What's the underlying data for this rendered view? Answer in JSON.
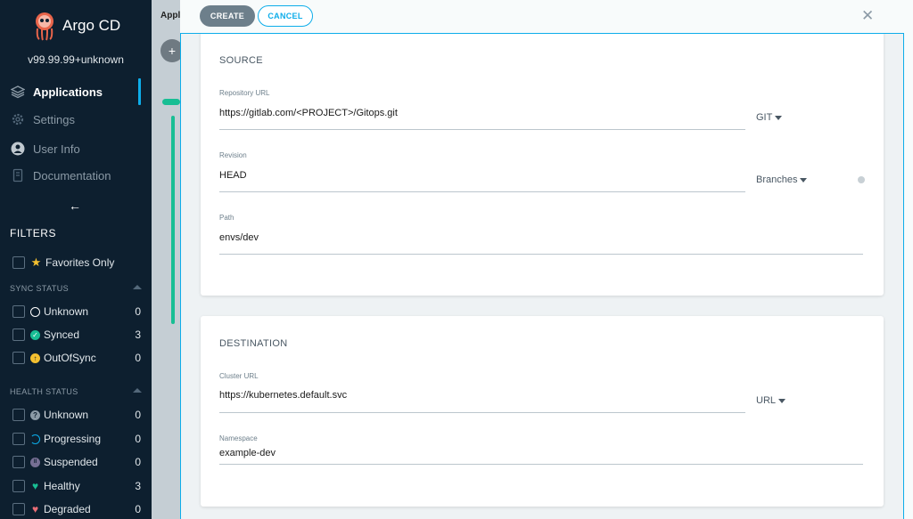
{
  "app": {
    "brand": "Argo CD",
    "version": "v99.99.99+unknown"
  },
  "nav": {
    "items": [
      {
        "label": "Applications",
        "icon": "stack-icon",
        "active": true
      },
      {
        "label": "Settings",
        "icon": "gear-icon",
        "active": false
      },
      {
        "label": "User Info",
        "icon": "user-icon",
        "active": false
      },
      {
        "label": "Documentation",
        "icon": "book-icon",
        "active": false
      }
    ]
  },
  "filters": {
    "title": "FILTERS",
    "favorites_label": "Favorites Only",
    "sync_status": {
      "title": "SYNC STATUS",
      "items": [
        {
          "label": "Unknown",
          "count": "0",
          "color": "#ffffff"
        },
        {
          "label": "Synced",
          "count": "3",
          "color": "#18be94"
        },
        {
          "label": "OutOfSync",
          "count": "0",
          "color": "#f4c030"
        }
      ]
    },
    "health_status": {
      "title": "HEALTH STATUS",
      "items": [
        {
          "label": "Unknown",
          "count": "0",
          "color": "#8b9aa6"
        },
        {
          "label": "Progressing",
          "count": "0",
          "color": "#0dadea"
        },
        {
          "label": "Suspended",
          "count": "0",
          "color": "#766f94"
        },
        {
          "label": "Healthy",
          "count": "3",
          "color": "#18be94"
        },
        {
          "label": "Degraded",
          "count": "0",
          "color": "#e96d76"
        }
      ]
    }
  },
  "background": {
    "title": "Appli"
  },
  "panel": {
    "create_label": "CREATE",
    "cancel_label": "CANCEL",
    "source": {
      "title": "SOURCE",
      "repo_label": "Repository URL",
      "repo_value": "https://gitlab.com/<PROJECT>/Gitops.git",
      "repo_type": "GIT",
      "revision_label": "Revision",
      "revision_value": "HEAD",
      "revision_type": "Branches",
      "path_label": "Path",
      "path_value": "envs/dev"
    },
    "destination": {
      "title": "DESTINATION",
      "cluster_label": "Cluster URL",
      "cluster_value": "https://kubernetes.default.svc",
      "cluster_type": "URL",
      "namespace_label": "Namespace",
      "namespace_value": "example-dev"
    }
  }
}
